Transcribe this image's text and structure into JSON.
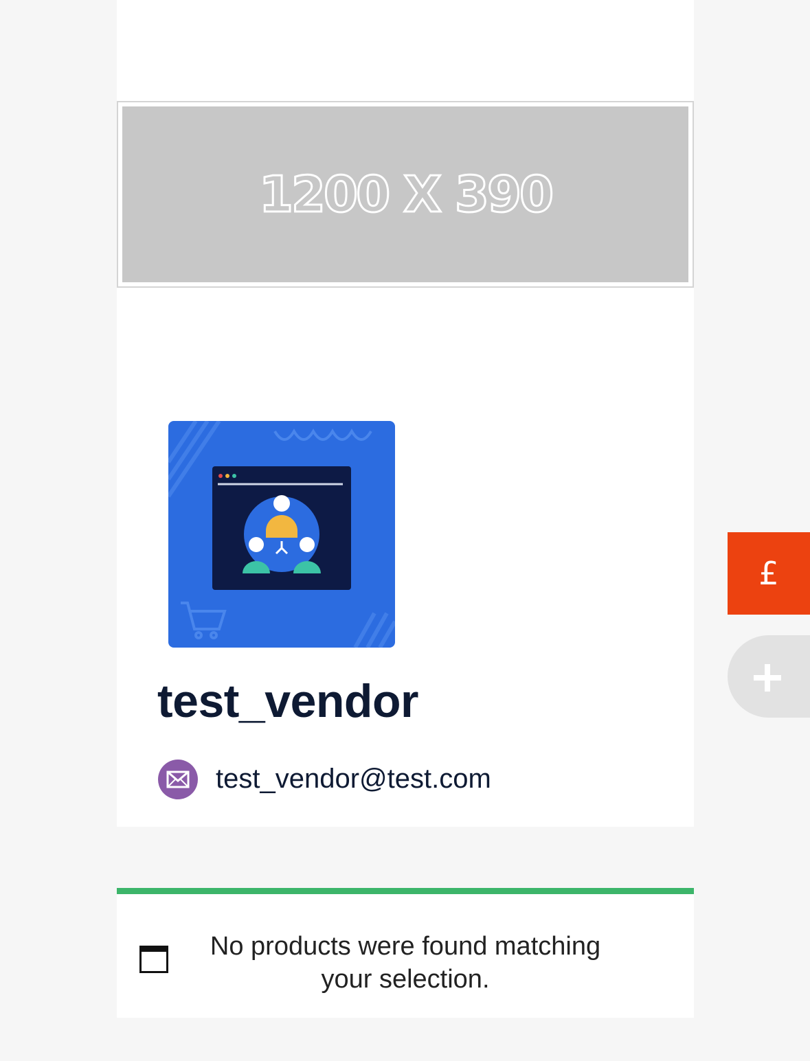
{
  "banner": {
    "placeholder_text": "1200 X 390"
  },
  "vendor": {
    "name": "test_vendor",
    "email": "test_vendor@test.com",
    "logo_icon": "team-network-icon"
  },
  "notice": {
    "text": "No products were found matching your selection.",
    "icon": "window-icon",
    "accent_color": "#3cb56a"
  },
  "floating_actions": {
    "currency_symbol": "£",
    "currency_color": "#ec4210",
    "add_icon": "plus-icon"
  },
  "colors": {
    "mail_icon": "#8a5aa8",
    "logo_bg": "#2c6ce0"
  }
}
